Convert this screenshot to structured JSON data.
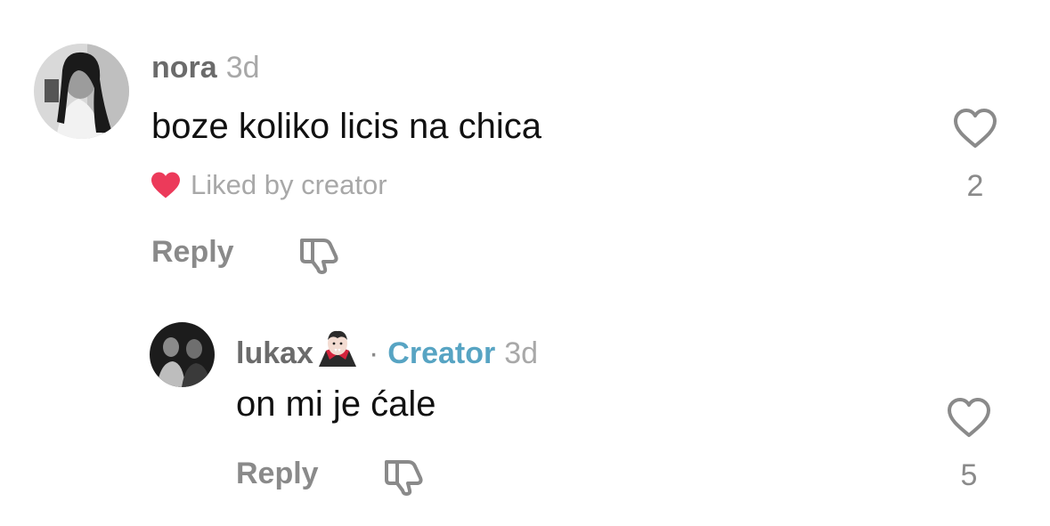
{
  "comments": [
    {
      "username": "nora",
      "timestamp": "3d",
      "text": "boze koliko licis na chica",
      "liked_by_label": "Liked by creator",
      "reply_label": "Reply",
      "like_count": "2"
    },
    {
      "username": "lukax",
      "emoji": "🧛🏻",
      "separator": "·",
      "badge": "Creator",
      "timestamp": "3d",
      "text": "on mi je ćale",
      "reply_label": "Reply",
      "like_count": "5"
    }
  ],
  "colors": {
    "heart_liked": "#ec3a5a",
    "creator_badge": "#57a4c3"
  },
  "icons": {
    "like": "heart-outline-icon",
    "dislike": "thumbs-down-icon",
    "liked_by": "heart-filled-icon"
  }
}
